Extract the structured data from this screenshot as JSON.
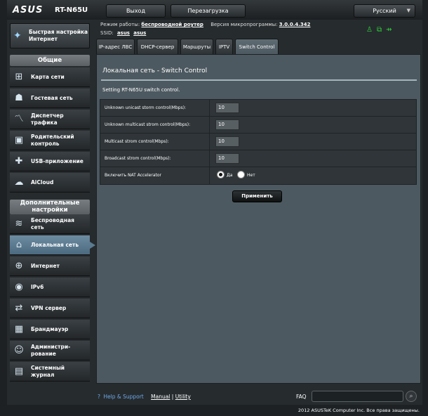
{
  "header": {
    "logo": "ASUS",
    "model": "RT-N65U",
    "logout_label": "Выход",
    "reboot_label": "Перезагрузка",
    "language": "Русский"
  },
  "status": {
    "mode_label": "Режим работы:",
    "mode_value": "беспроводной роутер",
    "firmware_label": "Версия микропрограммы:",
    "firmware_value": "3.0.0.4.342",
    "ssid_label": "SSID:",
    "ssid_values": [
      "asus",
      "asus"
    ]
  },
  "sidebar": {
    "quick_setup": "Быстрая настройка Интернет",
    "general_title": "Общие",
    "general_items": [
      {
        "label": "Карта сети",
        "icon": "network-map-icon"
      },
      {
        "label": "Гостевая сеть",
        "icon": "guest-network-icon"
      },
      {
        "label": "Диспетчер трафика",
        "icon": "traffic-manager-icon"
      },
      {
        "label": "Родительский контроль",
        "icon": "parental-control-icon"
      },
      {
        "label": "USB-приложение",
        "icon": "usb-app-icon"
      },
      {
        "label": "AiCloud",
        "icon": "aicloud-icon"
      }
    ],
    "advanced_title": "Дополнительные настройки",
    "advanced_items": [
      {
        "label": "Беспроводная сеть",
        "icon": "wireless-icon"
      },
      {
        "label": "Локальная сеть",
        "icon": "lan-home-icon"
      },
      {
        "label": "Интернет",
        "icon": "globe-icon"
      },
      {
        "label": "IPv6",
        "icon": "ipv6-icon"
      },
      {
        "label": "VPN сервер",
        "icon": "vpn-icon"
      },
      {
        "label": "Брандмауэр",
        "icon": "firewall-icon"
      },
      {
        "label": "Администри-рование",
        "icon": "admin-icon"
      },
      {
        "label": "Системный журнал",
        "icon": "system-log-icon"
      }
    ]
  },
  "tabs": [
    "IP-адрес ЛВС",
    "DHCP-сервер",
    "Маршруты",
    "IPTV",
    "Switch Control"
  ],
  "main": {
    "title": "Локальная сеть - Switch Control",
    "description": "Setting RT-N65U switch control.",
    "rows": [
      {
        "label": "Unknown unicast storm control(Mbps):",
        "value": "10"
      },
      {
        "label": "Unknown multicast strom control(Mbps):",
        "value": "10"
      },
      {
        "label": "Multicast strom control(Mbps):",
        "value": "10"
      },
      {
        "label": "Broadcast strom control(Mbps):",
        "value": "10"
      }
    ],
    "nat_label": "Включить NAT Accelerator",
    "nat_yes": "Да",
    "nat_no": "Нет",
    "nat_selected": "Да",
    "apply_label": "Применить"
  },
  "footer": {
    "help": "Help & Support",
    "manual": "Manual",
    "separator": "|",
    "utility": "Utility",
    "faq": "FAQ",
    "copyright": "2012 ASUSTeK Computer Inc. Все права защищены."
  },
  "colors": {
    "panel_bg": "#4d5960",
    "active_nav": "#5b7a90",
    "status_green": "#2fcf3a"
  }
}
